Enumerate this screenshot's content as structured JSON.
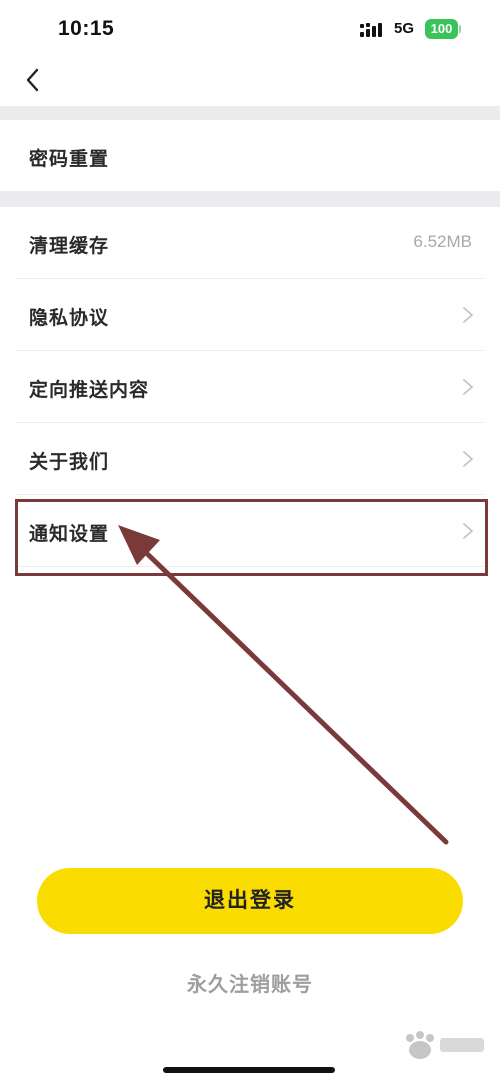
{
  "status_bar": {
    "time": "10:15",
    "network": "5G",
    "battery": "100"
  },
  "settings": {
    "section1": [
      {
        "label": "密码重置"
      }
    ],
    "section2": [
      {
        "label": "清理缓存",
        "value": "6.52MB"
      },
      {
        "label": "隐私协议"
      },
      {
        "label": "定向推送内容"
      },
      {
        "label": "关于我们"
      },
      {
        "label": "通知设置"
      }
    ]
  },
  "logout_label": "退出登录",
  "delete_account_label": "永久注销账号",
  "colors": {
    "accent_yellow": "#fadc00",
    "annotation": "#7a3a3a",
    "battery_green": "#3ac25b"
  }
}
